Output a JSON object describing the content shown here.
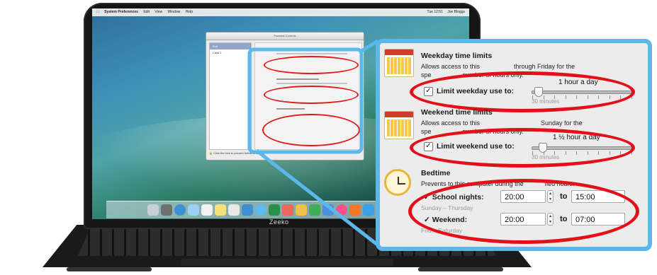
{
  "menubar": {
    "app": "System Preferences",
    "items": [
      "Edit",
      "View",
      "Window",
      "Help"
    ],
    "clock": "Tue 12:51",
    "user": "Joe Bloggs"
  },
  "laptop": {
    "brand": "Zeeko"
  },
  "mini_window": {
    "title": "Parental Controls",
    "users": [
      "Bob",
      "Child 1"
    ],
    "footer": "Click the lock to prevent further changes."
  },
  "weekday": {
    "title": "Weekday time limits",
    "desc_left": "Allows access to this",
    "desc_right": "through Friday for the",
    "desc2_left": "spe",
    "desc2_right": "number of hours only.",
    "checkbox_label": "Limit weekday use to:",
    "checked": true,
    "value": "1 hour a day",
    "min_label": "30 minutes",
    "level": 0.06
  },
  "weekend": {
    "title": "Weekend time limits",
    "desc_left": "Allows access to this",
    "desc_right": "Sunday for the",
    "desc2_left": "spe",
    "desc2_right": "number of hours only.",
    "checkbox_label": "Limit weekend use to:",
    "checked": true,
    "value": "1 ½ hour a day",
    "min_label": "30 minutes",
    "level": 0.1
  },
  "bedtime": {
    "title": "Bedtime",
    "desc_left": "Prevents",
    "desc_mid": "to this computer during the",
    "desc_right": "fied hours.",
    "school": {
      "label": "School nights:",
      "from": "20:00",
      "to": "15:00",
      "note": "Sunday – Thursday"
    },
    "weekend": {
      "label": "Weekend:",
      "from": "20:00",
      "to": "07:00",
      "note": "Frid... Saturday"
    },
    "to_label": "to"
  },
  "colors": {
    "accent_blue": "#5ab9ea",
    "highlight_red": "#e3101a"
  },
  "icons": [
    "calendar-weekday-icon",
    "calendar-weekend-icon",
    "clock-icon",
    "apple-icon",
    "lock-icon"
  ]
}
